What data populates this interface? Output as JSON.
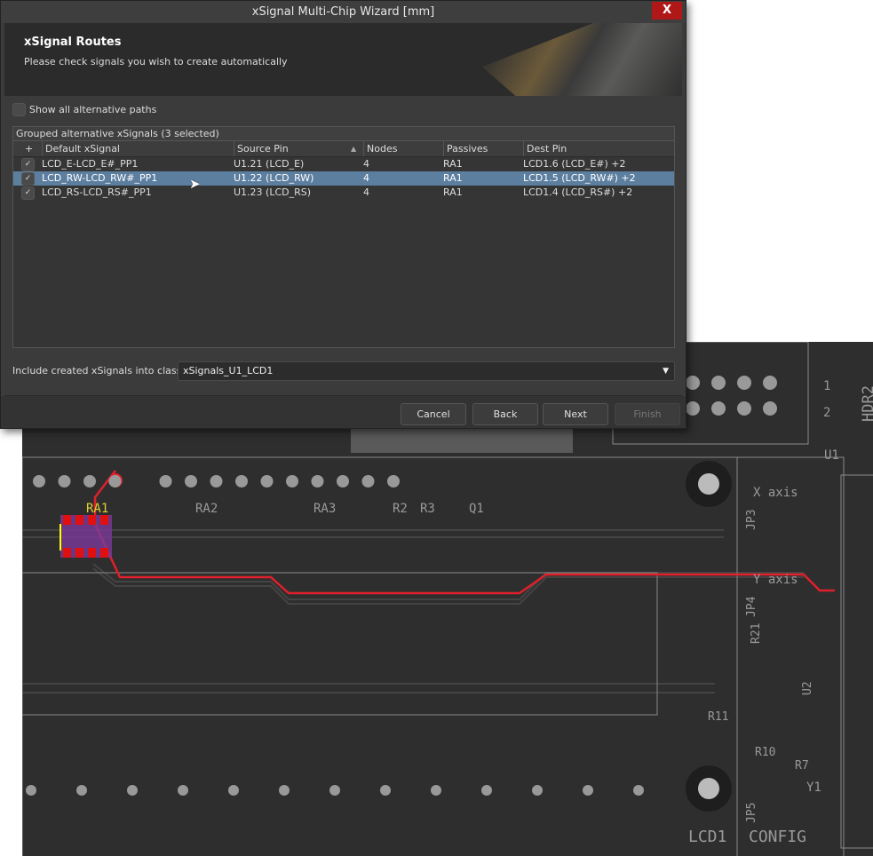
{
  "dialog": {
    "title": "xSignal Multi-Chip Wizard [mm]",
    "close_label": "X",
    "header_title": "xSignal Routes",
    "header_subtitle": "Please check signals you wish to create automatically",
    "show_all_label": "Show all alternative paths",
    "show_all_checked": false,
    "group_header": "Grouped alternative xSignals (3 selected)",
    "columns": [
      "+",
      "Default xSignal",
      "Source Pin",
      "Nodes",
      "Passives",
      "Dest Pin"
    ],
    "rows": [
      {
        "checked": "✓",
        "signal": "LCD_E-LCD_E#_PP1",
        "source": "U1.21 (LCD_E)",
        "nodes": "4",
        "passives": "RA1",
        "dest": "LCD1.6 (LCD_E#) +2"
      },
      {
        "checked": "✓",
        "signal": "LCD_RW-LCD_RW#_PP1",
        "source": "U1.22 (LCD_RW)",
        "nodes": "4",
        "passives": "RA1",
        "dest": "LCD1.5 (LCD_RW#) +2"
      },
      {
        "checked": "✓",
        "signal": "LCD_RS-LCD_RS#_PP1",
        "source": "U1.23 (LCD_RS)",
        "nodes": "4",
        "passives": "RA1",
        "dest": "LCD1.4 (LCD_RS#) +2"
      }
    ],
    "class_label": "Include created xSignals into class:",
    "class_value": "xSignals_U1_LCD1",
    "buttons": {
      "cancel": "Cancel",
      "back": "Back",
      "next": "Next",
      "finish": "Finish"
    }
  },
  "pcb": {
    "labels": {
      "ra1": "RA1",
      "ra2": "RA2",
      "ra3": "RA3",
      "r2": "R2",
      "r3": "R3",
      "q1": "Q1",
      "xaxis": "X axis",
      "yaxis": "Y axis",
      "jp3": "JP3",
      "jp4": "JP4",
      "r21": "R21",
      "r11": "R11",
      "r10": "R10",
      "r7": "R7",
      "u2": "U2",
      "u1": "U1",
      "y1": "Y1",
      "jp5": "JP5",
      "lcd1": "LCD1",
      "config": "CONFIG",
      "hdr2": "HDR2",
      "pin1": "1",
      "pin2": "2"
    },
    "route_color": "#e0202a"
  }
}
